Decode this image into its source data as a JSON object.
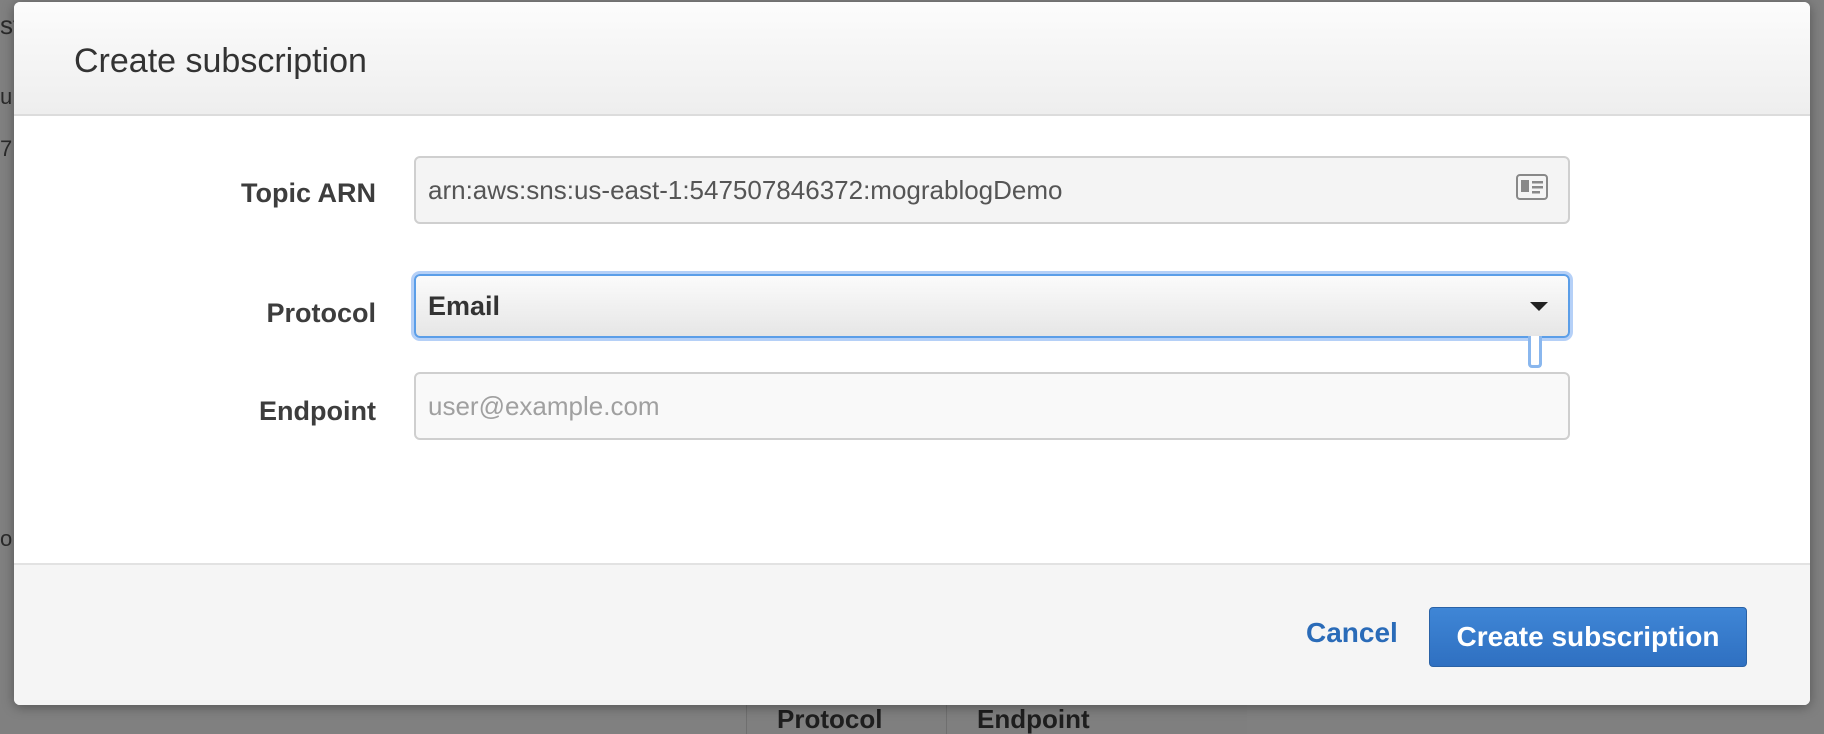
{
  "background": {
    "fragments": [
      "st",
      "u",
      "7",
      "o"
    ],
    "table_headers": [
      "Protocol",
      "Endpoint"
    ]
  },
  "dialog": {
    "title": "Create subscription",
    "topic_arn": {
      "label": "Topic ARN",
      "value": "arn:aws:sns:us-east-1:547507846372:mograblogDemo",
      "icon": "id-card-icon"
    },
    "protocol": {
      "label": "Protocol",
      "selected": "Email"
    },
    "endpoint": {
      "label": "Endpoint",
      "value": "",
      "placeholder": "user@example.com"
    },
    "footer": {
      "cancel_label": "Cancel",
      "submit_label": "Create subscription"
    }
  },
  "colors": {
    "accent": "#2f70c1",
    "link": "#2a6bb8",
    "focus": "#5b9ee8"
  }
}
